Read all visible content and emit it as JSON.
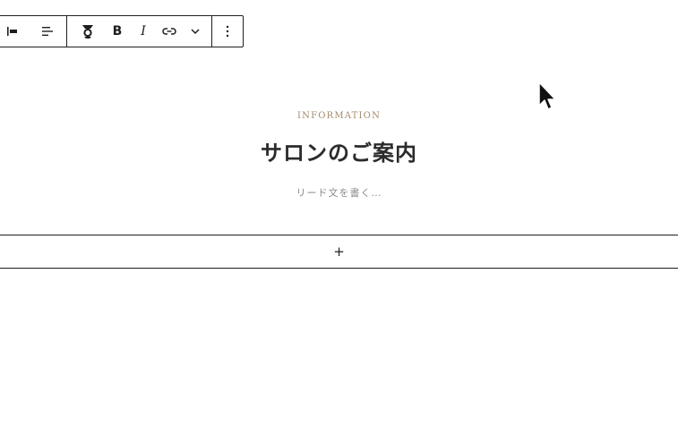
{
  "toolbar": {
    "icons": [
      "align-left-icon",
      "text-align-left-icon",
      "rich-text-icon",
      "bold-icon",
      "italic-icon",
      "link-icon",
      "chevron-down-icon",
      "more-vertical-icon"
    ],
    "bold_label": "B",
    "italic_label": "I"
  },
  "content": {
    "eyebrow": "INFORMATION",
    "heading": "サロンのご案内",
    "lead": "リード文を書く…"
  },
  "appender": {
    "label": "+"
  },
  "colors": {
    "eyebrow": "#a38b6d",
    "heading": "#2b2b2b",
    "lead": "#8a8a8a",
    "border": "#1e1e1e"
  }
}
